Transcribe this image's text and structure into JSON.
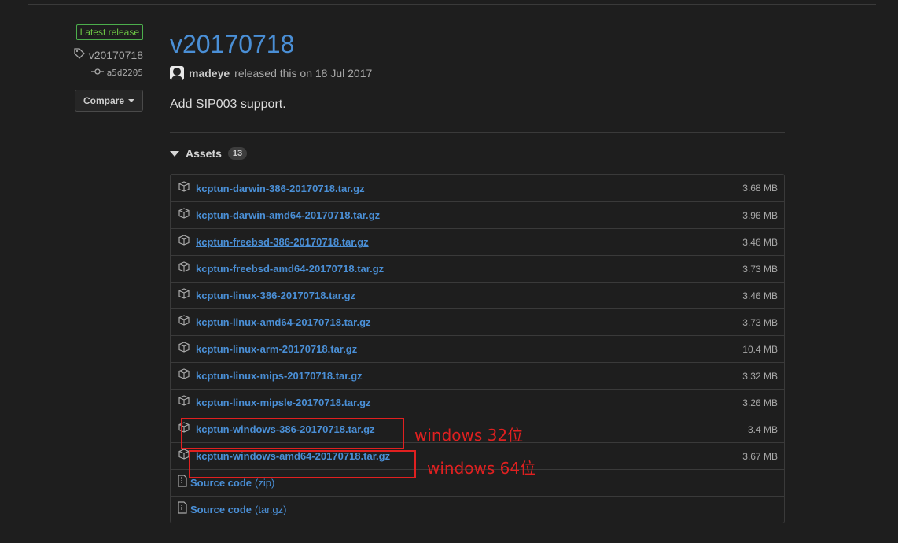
{
  "release": {
    "badge": "Latest release",
    "tag": "v20170718",
    "commit": "a5d2205",
    "compare_label": "Compare",
    "title": "v20170718",
    "author": "madeye",
    "byline": "released this on 18 Jul 2017",
    "description": "Add SIP003 support."
  },
  "assets": {
    "label": "Assets",
    "count": "13",
    "items": [
      {
        "name": "kcptun-darwin-386-20170718.tar.gz",
        "size": "3.68 MB"
      },
      {
        "name": "kcptun-darwin-amd64-20170718.tar.gz",
        "size": "3.96 MB"
      },
      {
        "name": "kcptun-freebsd-386-20170718.tar.gz",
        "size": "3.46 MB"
      },
      {
        "name": "kcptun-freebsd-amd64-20170718.tar.gz",
        "size": "3.73 MB"
      },
      {
        "name": "kcptun-linux-386-20170718.tar.gz",
        "size": "3.46 MB"
      },
      {
        "name": "kcptun-linux-amd64-20170718.tar.gz",
        "size": "3.73 MB"
      },
      {
        "name": "kcptun-linux-arm-20170718.tar.gz",
        "size": "10.4 MB"
      },
      {
        "name": "kcptun-linux-mips-20170718.tar.gz",
        "size": "3.32 MB"
      },
      {
        "name": "kcptun-linux-mipsle-20170718.tar.gz",
        "size": "3.26 MB"
      },
      {
        "name": "kcptun-windows-386-20170718.tar.gz",
        "size": "3.4 MB"
      },
      {
        "name": "kcptun-windows-amd64-20170718.tar.gz",
        "size": "3.67 MB"
      }
    ],
    "source": [
      {
        "name": "Source code",
        "suffix": "(zip)"
      },
      {
        "name": "Source code",
        "suffix": "(tar.gz)"
      }
    ]
  },
  "annotations": {
    "win32": "windows 32位",
    "win64": "windows 64位",
    "color": "#e02020"
  },
  "icons": {
    "tag": "tag-icon",
    "commit": "commit-icon",
    "package": "package-icon",
    "file_zip": "file-zip-icon",
    "caret": "chevron-down-icon",
    "collapse": "triangle-down-icon"
  }
}
